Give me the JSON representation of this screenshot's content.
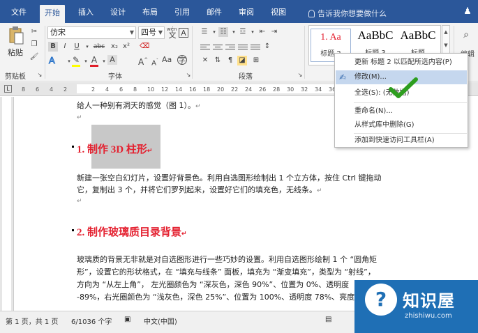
{
  "tabs": [
    "文件",
    "开始",
    "插入",
    "设计",
    "布局",
    "引用",
    "邮件",
    "审阅",
    "视图"
  ],
  "tell_me": "告诉我你想要做什么",
  "ribbon": {
    "paste_label": "粘贴",
    "clipboard_label": "剪贴板",
    "font_label": "字体",
    "paragraph_label": "段落",
    "editing_label": "编辑",
    "font_name": "仿宋",
    "font_size": "四号",
    "wen_label": "wén",
    "styles": [
      {
        "sample": "1.  Aa",
        "name": "标题 2"
      },
      {
        "sample": "AaBbC",
        "name": "标题 3"
      },
      {
        "sample": "AaBbC",
        "name": "标题"
      }
    ]
  },
  "ruler_ticks": [
    "8",
    "6",
    "4",
    "2",
    "",
    "2",
    "4",
    "6",
    "8",
    "10",
    "12",
    "14",
    "16",
    "18",
    "20",
    "22",
    "24",
    "26",
    "28",
    "30",
    "32",
    "34",
    "36",
    "38",
    "40",
    "42"
  ],
  "document": {
    "line1": "给人一种别有洞天的感觉（图 1）。",
    "heading1": "1.  制作 3D 柱形",
    "para1_l1": "新建一张空白幻灯片，设置好背景色。利用自选图形绘制出 1 个立方体，按住 Ctrl 键拖动",
    "para1_l2": "它，复制出 3 个，并将它们罗列起来，设置好它们的填充色，无线条。",
    "heading2": "2.  制作玻璃质目录背景",
    "para2_l1": "玻璃质的背景无非就是对自选图形进行一些巧妙的设置。利用自选图形绘制 1 个 “圆角矩",
    "para2_l2": "形”，设置它的形状格式，在 “填充与线条” 面板，填充为 “渐变填充”，类型为 “射线”，",
    "para2_l3": "方向为 “从左上角”， 左光圈颜色为 “深灰色，深色 90%”、位置为 0%、透明度",
    "para2_l4": "-89%，右光圈颜色为 “浅灰色，深色 25%”、位置为 100%、透明度 78%、亮度"
  },
  "context_menu": [
    "更新 标题 2 以匹配所选内容(P)",
    "修改(M)...",
    "全选(S): (无数据)",
    "重命名(N)...",
    "从样式库中删除(G)",
    "添加到快速访问工具栏(A)"
  ],
  "status": {
    "page": "第 1 页，共 1 页",
    "words": "6/1036 个字",
    "lang": "中文(中国)"
  },
  "watermark": {
    "name": "知识屋",
    "url": "zhishiwu.com",
    "q": "?"
  },
  "colors": {
    "accent": "#2b579a",
    "heading_red": "#e4202f",
    "check_green": "#2e9e1f"
  }
}
